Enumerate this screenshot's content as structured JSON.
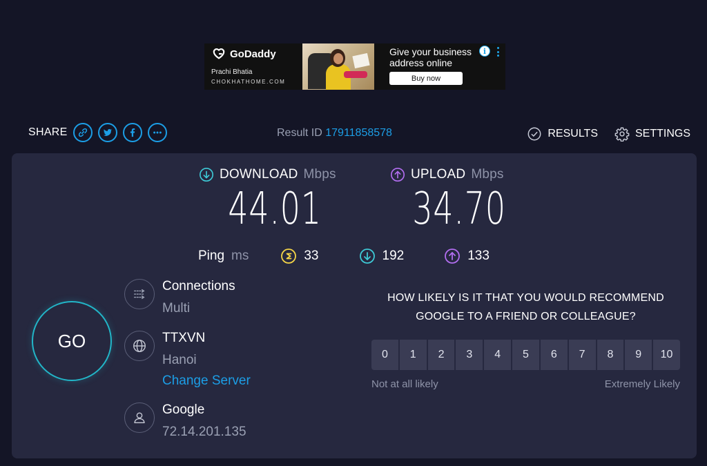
{
  "ad": {
    "brand": "GoDaddy",
    "person": "Prachi Bhatia",
    "site": "CHOKHATHOME.COM",
    "headline": "Give your business address online",
    "button": "Buy now",
    "info_glyph": "i"
  },
  "share": {
    "label": "SHARE",
    "icons": [
      "link-icon",
      "twitter-icon",
      "facebook-icon",
      "more-icon"
    ]
  },
  "result": {
    "label": "Result ID",
    "id": "17911858578"
  },
  "nav": {
    "results": "RESULTS",
    "settings": "SETTINGS"
  },
  "download": {
    "label": "DOWNLOAD",
    "unit": "Mbps",
    "value": "44.01"
  },
  "upload": {
    "label": "UPLOAD",
    "unit": "Mbps",
    "value": "34.70"
  },
  "ping": {
    "label": "Ping",
    "unit": "ms",
    "idle": "33",
    "download": "192",
    "upload": "133"
  },
  "go_label": "GO",
  "connections": {
    "title": "Connections",
    "value": "Multi"
  },
  "server": {
    "title": "TTXVN",
    "location": "Hanoi",
    "change_link": "Change Server"
  },
  "provider": {
    "title": "Google",
    "ip": "72.14.201.135"
  },
  "survey": {
    "question": "HOW LIKELY IS IT THAT YOU WOULD RECOMMEND GOOGLE TO A FRIEND OR COLLEAGUE?",
    "scale": [
      "0",
      "1",
      "2",
      "3",
      "4",
      "5",
      "6",
      "7",
      "8",
      "9",
      "10"
    ],
    "low_label": "Not at all likely",
    "high_label": "Extremely Likely"
  },
  "colors": {
    "background": "#141526",
    "panel": "#26283f",
    "accent_blue": "#1c9ee6",
    "download_teal": "#3ec9d6",
    "upload_purple": "#b26ef0",
    "ping_yellow": "#f5d547"
  }
}
